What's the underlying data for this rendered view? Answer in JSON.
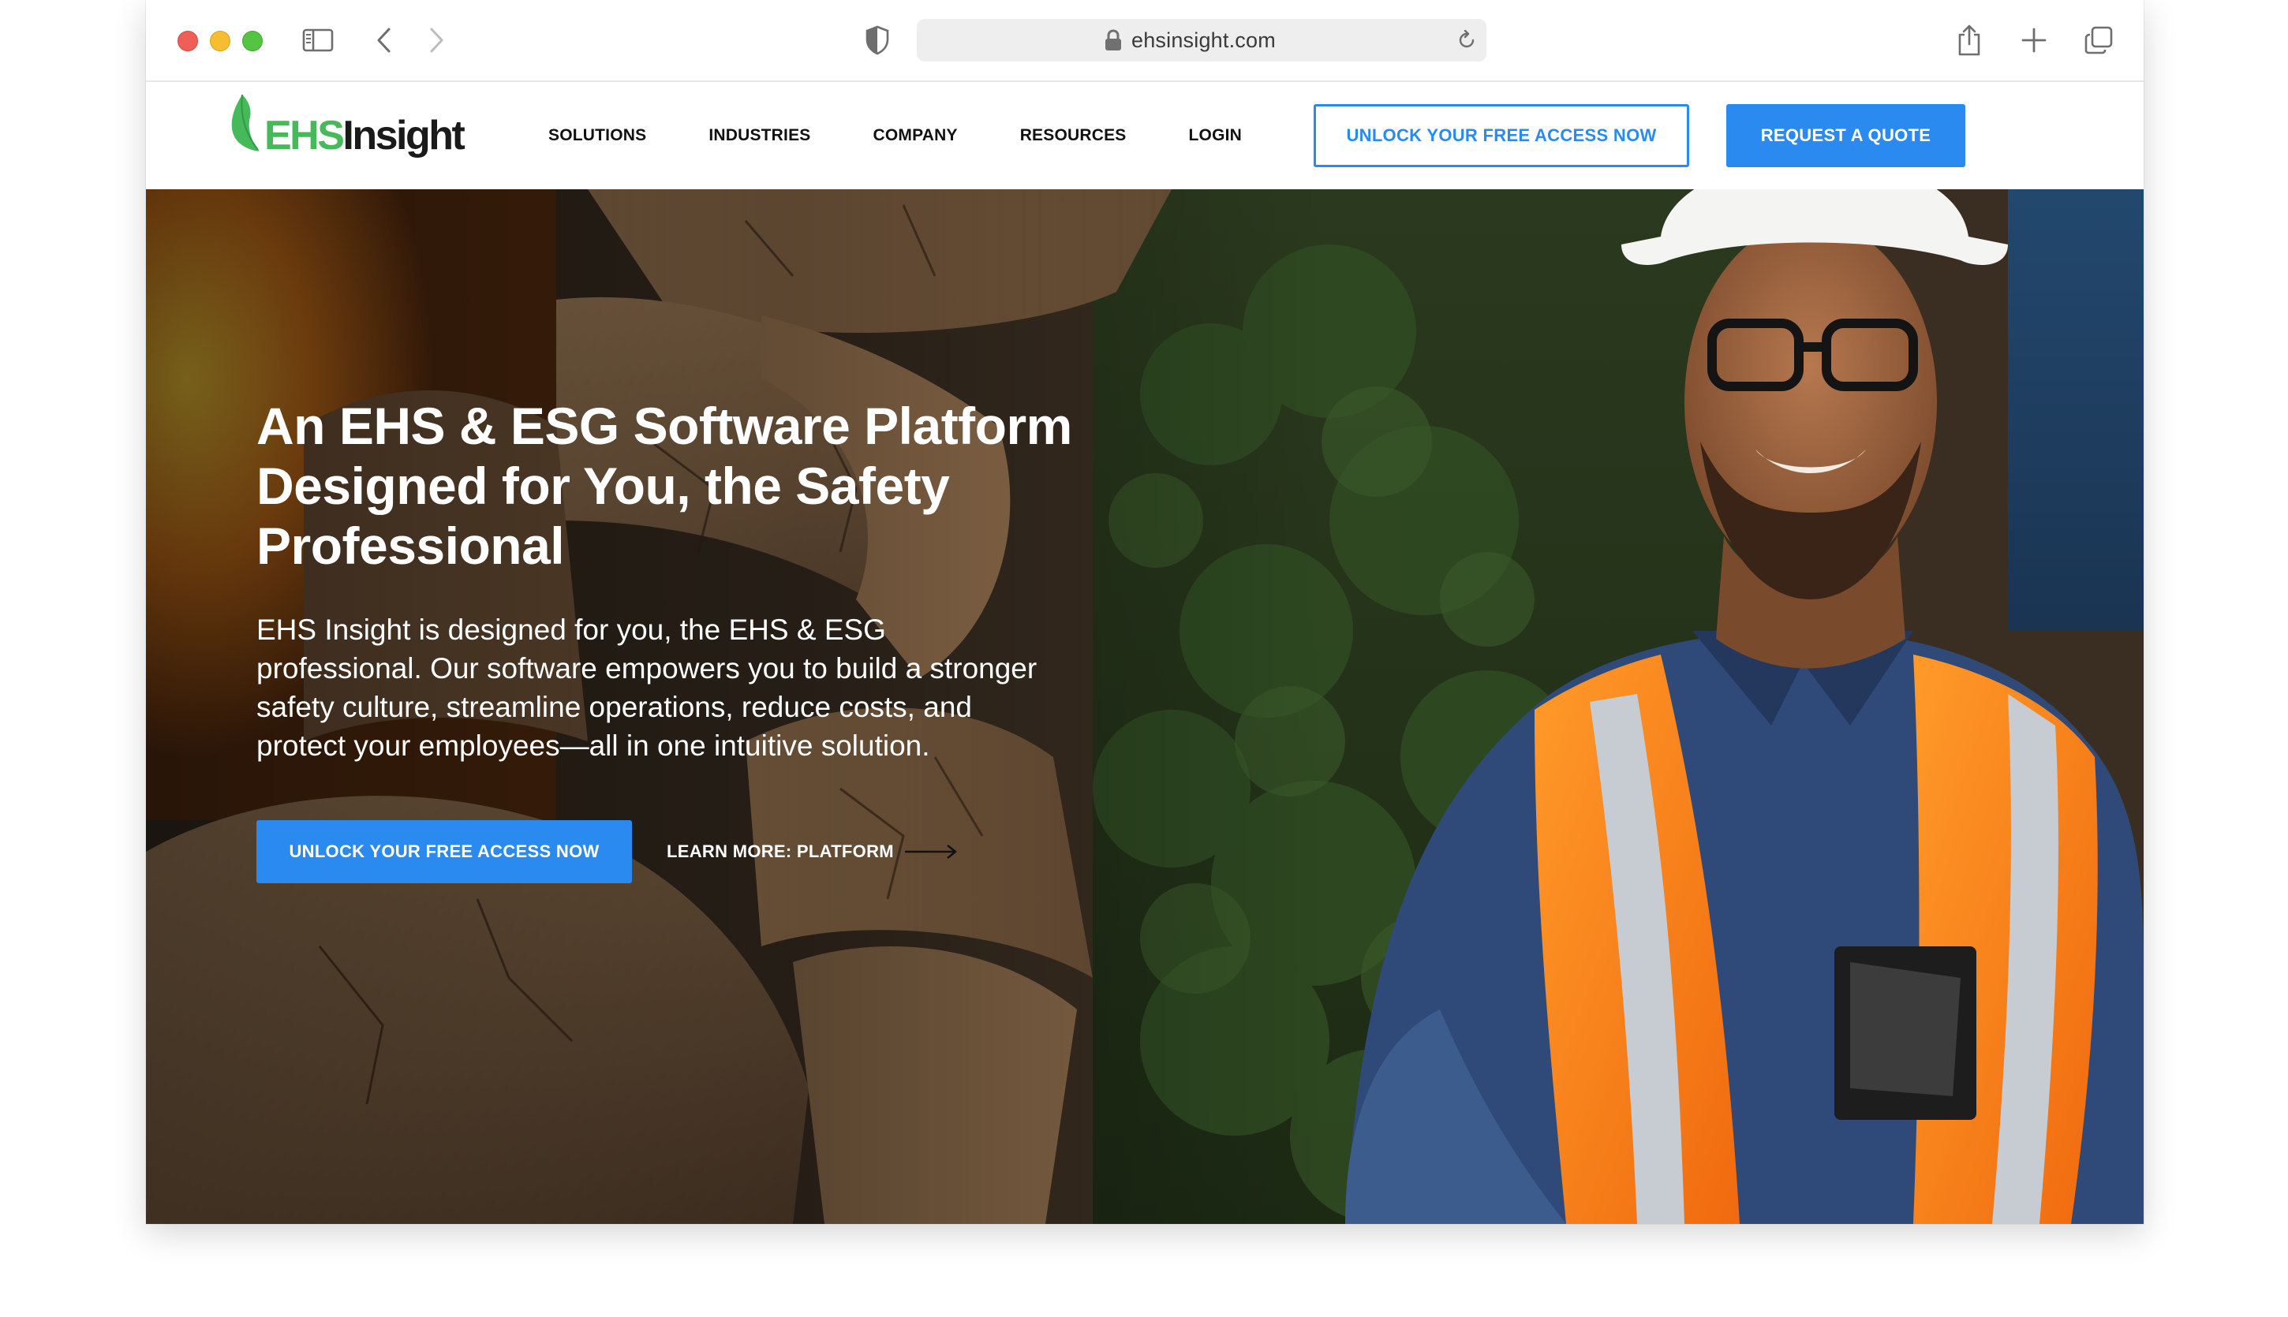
{
  "browser": {
    "url": "ehsinsight.com",
    "icons": [
      "sidebar-icon",
      "back-icon",
      "forward-icon",
      "privacy-shield-icon",
      "lock-icon",
      "reload-icon",
      "share-icon",
      "new-tab-icon",
      "tabs-overview-icon"
    ]
  },
  "header": {
    "logo": {
      "part1": "EHS",
      "part2": "Insight"
    },
    "nav": [
      {
        "label": "SOLUTIONS"
      },
      {
        "label": "INDUSTRIES"
      },
      {
        "label": "COMPANY"
      },
      {
        "label": "RESOURCES"
      },
      {
        "label": "LOGIN"
      }
    ],
    "outline_button": "UNLOCK YOUR FREE ACCESS NOW",
    "quote_button": "REQUEST A QUOTE"
  },
  "hero": {
    "title": "An EHS & ESG Software Platform Designed for You, the Safety Professional",
    "body": "EHS Insight is designed for you, the EHS & ESG professional. Our software empowers you to build a stronger safety culture, streamline operations, reduce costs, and protect your employees—all in one intuitive solution.",
    "cta": "UNLOCK YOUR FREE ACCESS NOW",
    "link": "LEARN MORE: PLATFORM"
  },
  "colors": {
    "accent": "#2a8af0",
    "logo_green": "#46b95a",
    "vest_orange": "#ff8a1c",
    "text_dark": "#111111"
  }
}
